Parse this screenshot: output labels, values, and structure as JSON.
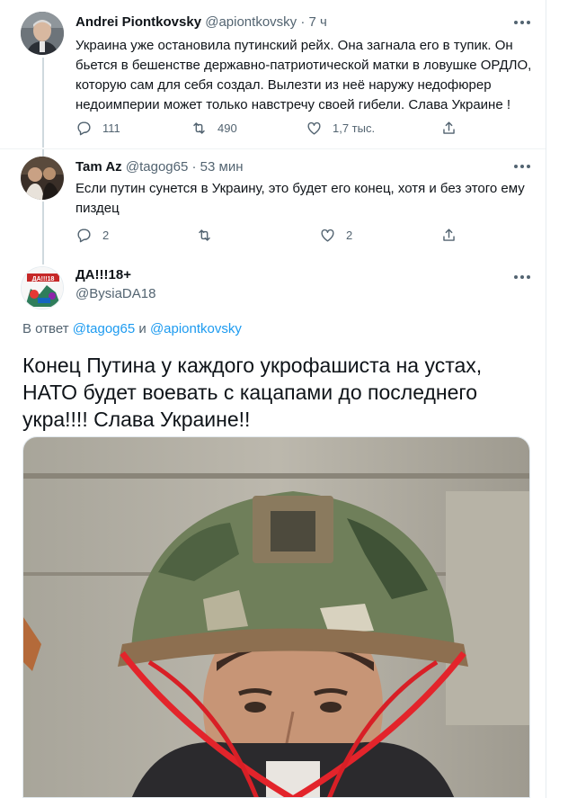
{
  "tweets": [
    {
      "name": "Andrei Piontkovsky",
      "handle": "@apiontkovsky",
      "sep": "·",
      "time": "7 ч",
      "text_lines": [
        "Украина уже остановила путинский рейх. Она загнала его в тупик. Он",
        "бьется в бешенстве державно-патриотической матки в ловушке ОРДЛО,",
        "которую сам для себя создал. Вылезти из неё наружу недофюрер",
        "недоимперии  может только навстречу своей гибели. Слава Украине !"
      ],
      "replies": "111",
      "retweets": "490",
      "likes": "1,7 тыс."
    },
    {
      "name": "Tam Az",
      "handle": "@tagog65",
      "sep": "·",
      "time": "53 мин",
      "text_lines": [
        "Если путин сунется в Украину, это будет его конец, хотя и без этого ему",
        "пиздец"
      ],
      "replies": "2",
      "retweets": "",
      "likes": "2"
    }
  ],
  "main_tweet": {
    "name": "ДА!!!18+",
    "handle": "@BysiaDA18",
    "reply_prefix": "В ответ",
    "mention_1": "@tagog65",
    "conjunction": "и",
    "mention_2": "@apiontkovsky",
    "text_lines": [
      "Конец Путина у каждого укрофашиста на устах,",
      "НАТО будет воевать с кацапами до последнего",
      "укра!!!! Слава Украине!!"
    ],
    "avatar_text": "ДА!!!18+"
  },
  "icons": {
    "reply": "reply-icon",
    "retweet": "retweet-icon",
    "like": "like-icon",
    "share": "share-icon",
    "more": "more-icon"
  },
  "colors": {
    "text": "#0f1419",
    "secondary": "#536471",
    "link": "#1d9bf0",
    "thread_line": "#cfd9de"
  }
}
